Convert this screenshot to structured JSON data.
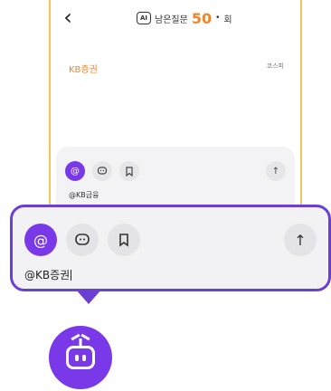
{
  "header": {
    "ai_badge": "AI",
    "remaining_label": "남은질문",
    "remaining_count": "50",
    "separator": "•",
    "unit": "회"
  },
  "stock": {
    "company": "KB증권",
    "market": "코스피"
  },
  "input": {
    "small_text": "@KB금융",
    "large_text": "@KB증권"
  },
  "icons": {
    "back": "back-icon",
    "mention": "at-icon",
    "chat": "chat-icon",
    "bookmark": "bookmark-icon",
    "send": "arrow-up-icon",
    "bot": "robot-icon"
  },
  "colors": {
    "accent": "#7a39e8",
    "callout_border": "#6b3fd4",
    "count": "#f0862c",
    "phone_border": "#f1c55a"
  }
}
